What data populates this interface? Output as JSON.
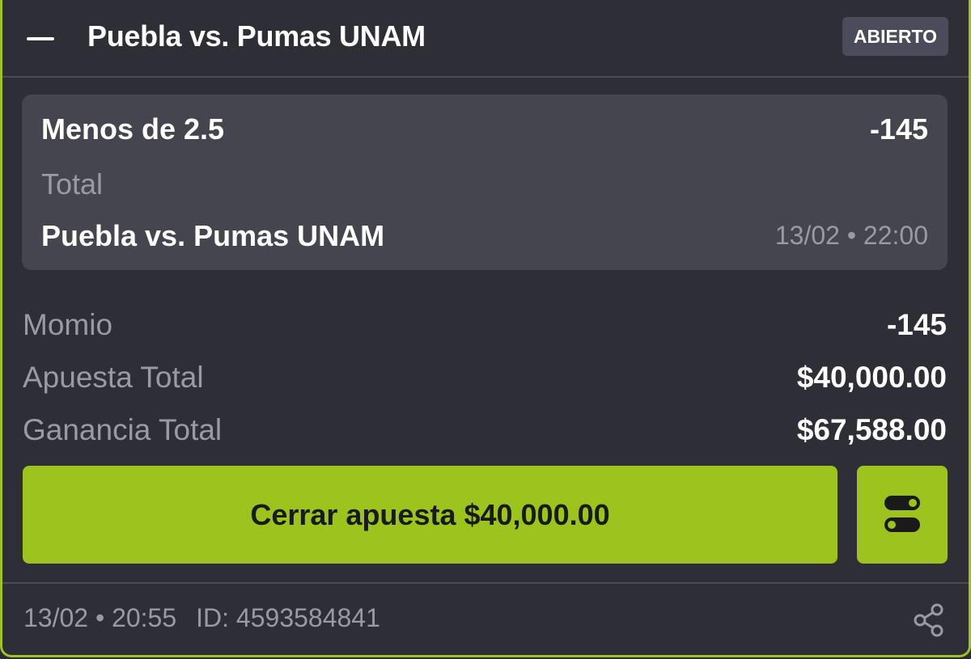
{
  "header": {
    "title": "Puebla vs. Pumas UNAM",
    "status": "ABIERTO"
  },
  "selection": {
    "name": "Menos de 2.5",
    "odds": "-145",
    "market": "Total",
    "event": "Puebla vs. Pumas UNAM",
    "datetime": "13/02 • 22:00"
  },
  "summary": {
    "odds_label": "Momio",
    "odds_value": "-145",
    "stake_label": "Apuesta Total",
    "stake_value": "$40,000.00",
    "payout_label": "Ganancia Total",
    "payout_value": "$67,588.00"
  },
  "actions": {
    "cashout_label": "Cerrar apuesta $40,000.00",
    "toggle_icon": "toggle-icon"
  },
  "footer": {
    "datetime": "13/02 • 20:55",
    "bet_id": "ID: 4593584841",
    "share_icon": "share-icon"
  },
  "colors": {
    "accent": "#9cc41c",
    "background": "#2e2e37",
    "panel": "#45454f",
    "muted_text": "#9a9aa3"
  }
}
